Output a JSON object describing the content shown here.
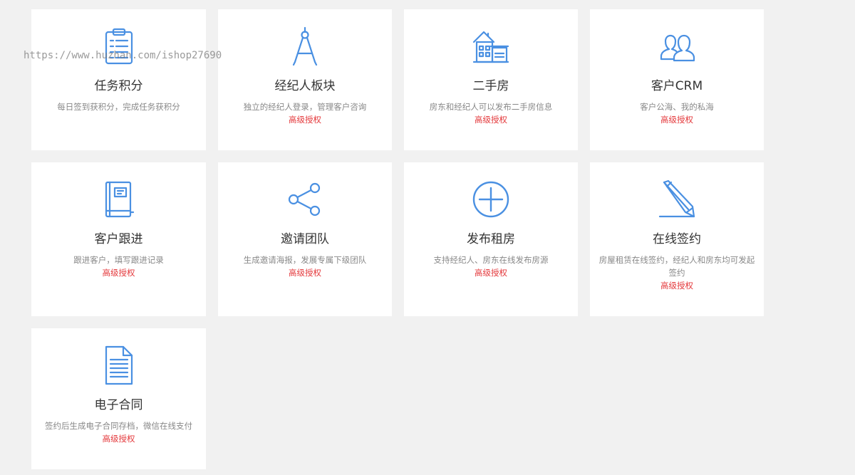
{
  "accent_color": "#4a90e2",
  "badge_color": "#e4393c",
  "watermark": "https://www.huzhan.com/ishop27690",
  "modules": [
    {
      "id": "tasks",
      "icon": "clipboard-icon",
      "title": "任务积分",
      "desc": "每日签到获积分，完成任务获积分",
      "badge": ""
    },
    {
      "id": "agent",
      "icon": "compass-icon",
      "title": "经纪人板块",
      "desc": "独立的经纪人登录，管理客户咨询",
      "badge": "高级授权"
    },
    {
      "id": "secondhand",
      "icon": "building-icon",
      "title": "二手房",
      "desc": "房东和经纪人可以发布二手房信息",
      "badge": "高级授权"
    },
    {
      "id": "crm",
      "icon": "users-icon",
      "title": "客户CRM",
      "desc": "客户公海、我的私海",
      "badge": "高级授权"
    },
    {
      "id": "followup",
      "icon": "book-icon",
      "title": "客户跟进",
      "desc": "跟进客户，填写跟进记录",
      "badge": "高级授权"
    },
    {
      "id": "team",
      "icon": "share-icon",
      "title": "邀请团队",
      "desc": "生成邀请海报，发展专属下级团队",
      "badge": "高级授权"
    },
    {
      "id": "rent",
      "icon": "plus-circle-icon",
      "title": "发布租房",
      "desc": "支持经纪人、房东在线发布房源",
      "badge": "高级授权"
    },
    {
      "id": "sign",
      "icon": "pencil-icon",
      "title": "在线签约",
      "desc": "房屋租赁在线签约，经纪人和房东均可发起签约",
      "badge": "高级授权"
    },
    {
      "id": "contract",
      "icon": "document-icon",
      "title": "电子合同",
      "desc": "签约后生成电子合同存档，微信在线支付",
      "badge": "高级授权"
    }
  ]
}
